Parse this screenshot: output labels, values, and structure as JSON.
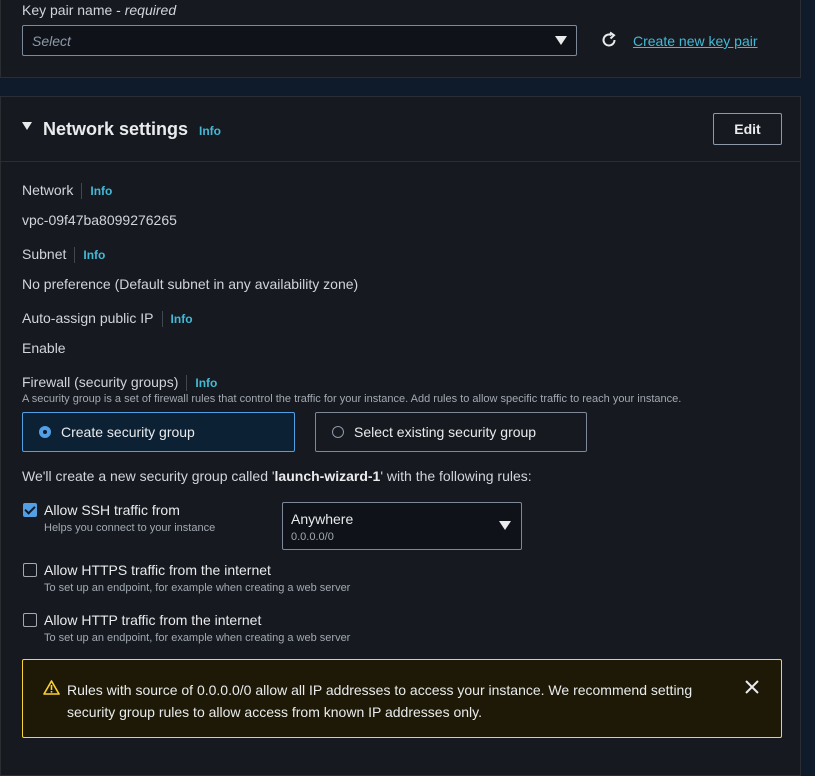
{
  "key_pair": {
    "label": "Key pair name",
    "required": "required",
    "placeholder": "Select",
    "create_link": "Create new key pair"
  },
  "network_settings": {
    "title": "Network settings",
    "info": "Info",
    "edit_button": "Edit",
    "network": {
      "label": "Network",
      "info": "Info",
      "value": "vpc-09f47ba8099276265"
    },
    "subnet": {
      "label": "Subnet",
      "info": "Info",
      "value": "No preference (Default subnet in any availability zone)"
    },
    "auto_ip": {
      "label": "Auto-assign public IP",
      "info": "Info",
      "value": "Enable"
    },
    "firewall": {
      "label": "Firewall (security groups)",
      "info": "Info",
      "description": "A security group is a set of firewall rules that control the traffic for your instance. Add rules to allow specific traffic to reach your instance.",
      "options": [
        "Create security group",
        "Select existing security group"
      ],
      "selected": "Create security group"
    },
    "sg_note_prefix": "We'll create a new security group called '",
    "sg_name": "launch-wizard-1",
    "sg_note_suffix": "' with the following rules:",
    "rules": [
      {
        "title": "Allow SSH traffic from",
        "desc": "Helps you connect to your instance",
        "checked": true
      },
      {
        "title": "Allow HTTPS traffic from the internet",
        "desc": "To set up an endpoint, for example when creating a web server",
        "checked": false
      },
      {
        "title": "Allow HTTP traffic from the internet",
        "desc": "To set up an endpoint, for example when creating a web server",
        "checked": false
      }
    ],
    "ssh_source": {
      "value": "Anywhere",
      "sub": "0.0.0.0/0"
    },
    "warning": {
      "line1": "Rules with source of 0.0.0.0/0 allow all IP addresses to access your instance. We recommend setting",
      "line2": "security group rules to allow access from known IP addresses only."
    }
  },
  "colors": {
    "accent": "#539fe5",
    "link": "#44b9d6",
    "warning": "#fbd332"
  },
  "icons": [
    "refresh-icon",
    "caret-down-icon",
    "warning-icon",
    "close-icon"
  ]
}
